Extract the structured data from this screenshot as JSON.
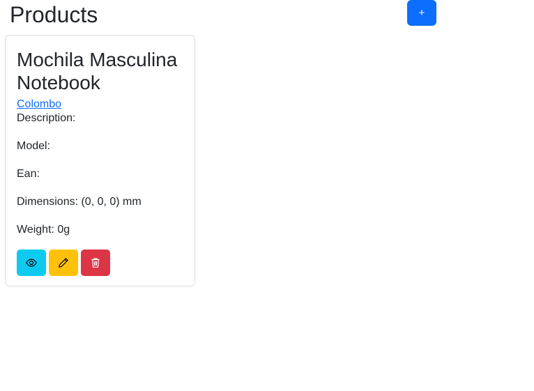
{
  "header": {
    "title": "Products",
    "add_label": "+"
  },
  "products": [
    {
      "name": "Mochila Masculina Notebook",
      "brand": "Colombo",
      "description_label": "Description:",
      "model_label": "Model:",
      "ean_label": "Ean:",
      "dimensions_label": "Dimensions: (0, 0, 0) mm",
      "weight_label": "Weight: 0g",
      "actions": {
        "view_icon": "eye-icon",
        "edit_icon": "pencil-icon",
        "delete_icon": "trash-icon"
      }
    }
  ],
  "colors": {
    "primary": "#0d6efd",
    "info": "#0dcaf0",
    "warning": "#ffc107",
    "danger": "#dc3545"
  }
}
